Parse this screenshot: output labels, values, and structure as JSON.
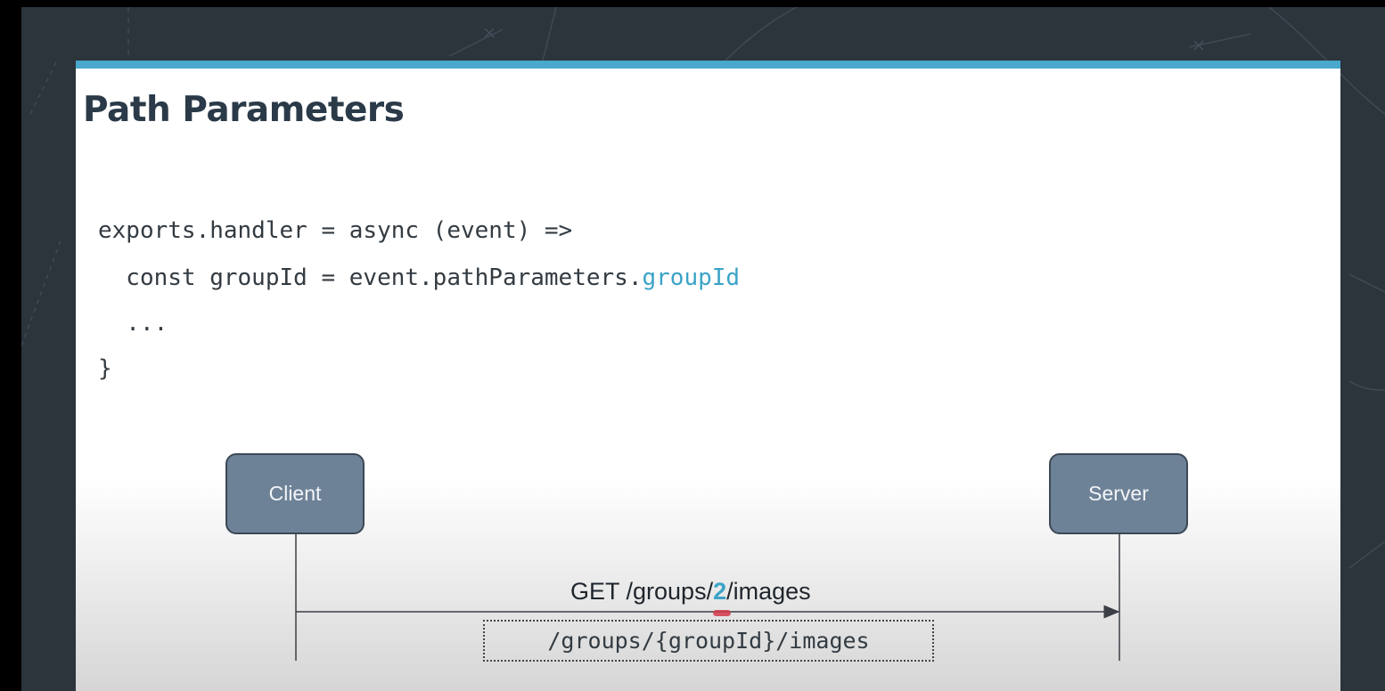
{
  "slide": {
    "title": "Path Parameters",
    "code": {
      "line1": "exports.handler = async (event) =>",
      "line2_prefix": "  const groupId = event.pathParameters.",
      "line2_highlight": "groupId",
      "line3": "  ...",
      "line4": "}"
    },
    "diagram": {
      "client_label": "Client",
      "server_label": "Server",
      "request_prefix": "GET /groups/",
      "request_param": "2",
      "request_suffix": "/images",
      "route_template": "/groups/{groupId}/images"
    }
  },
  "colors": {
    "accent": "#4aa8cc",
    "highlight": "#3ba3c7",
    "node_fill": "#6e8297",
    "background": "#2c343c"
  }
}
